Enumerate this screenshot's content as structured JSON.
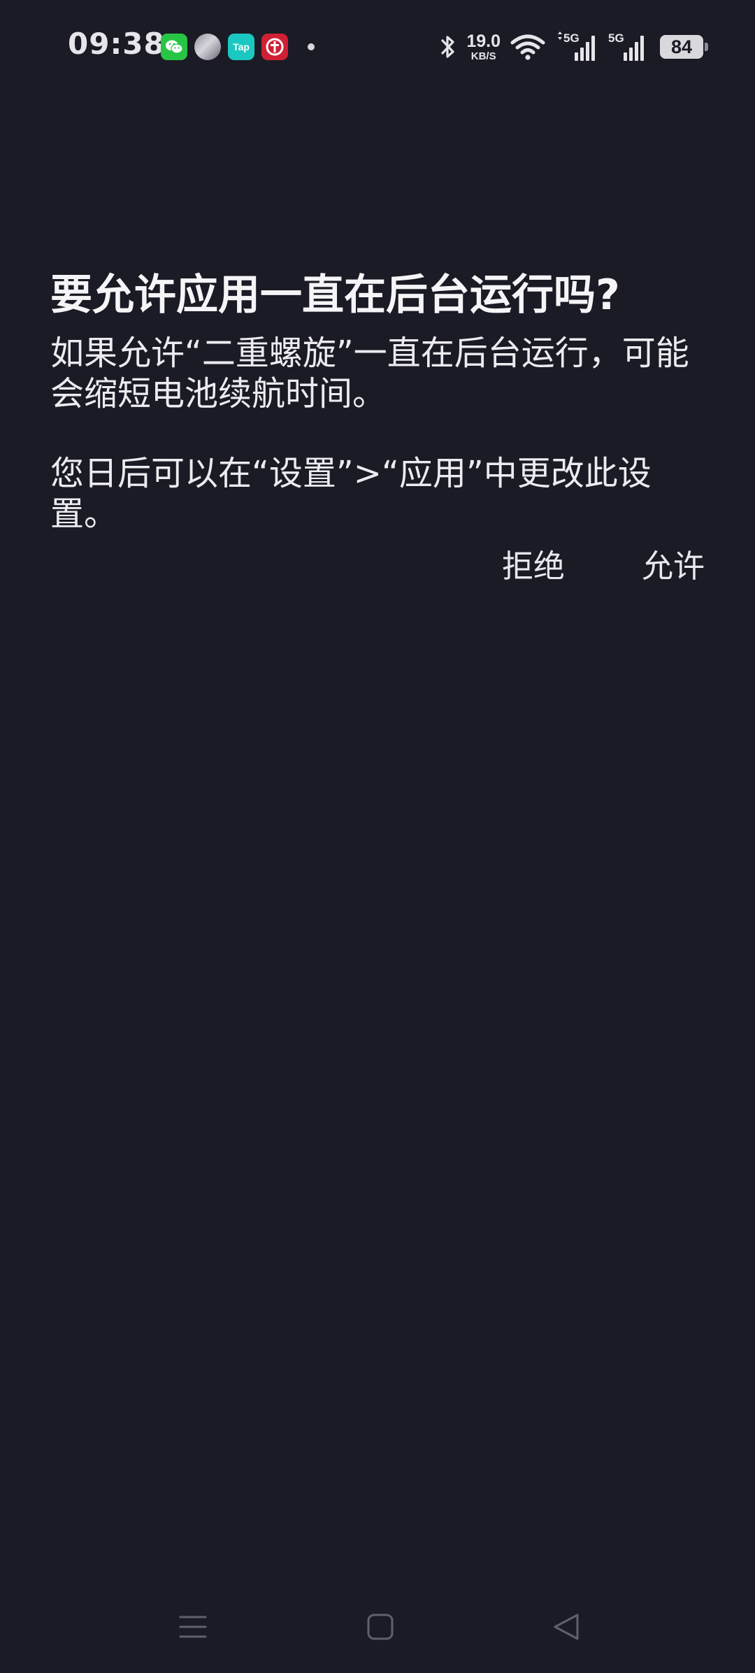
{
  "status_bar": {
    "time": "09:38",
    "notification_icons": [
      {
        "name": "wechat-icon",
        "label": ""
      },
      {
        "name": "game-avatar-icon",
        "label": ""
      },
      {
        "name": "taptap-icon",
        "label": "Tap"
      },
      {
        "name": "railway-icon",
        "label": ""
      }
    ],
    "net_speed_value": "19.0",
    "net_speed_unit": "KB/S",
    "signal_1_label": "5G",
    "signal_2_label": "5G",
    "battery_level": "84",
    "colors": {
      "background": "#1a1b25",
      "text": "#e6e6ea"
    }
  },
  "dialog": {
    "title": "要允许应用一直在后台运行吗?",
    "message": "如果允许“二重螺旋”一直在后台运行，可能会缩短电池续航时间。",
    "hint": "您日后可以在“设置”>“应用”中更改此设置。",
    "deny_label": "拒绝",
    "allow_label": "允许"
  },
  "nav_bar": {
    "icons": [
      "menu-icon",
      "home-icon",
      "back-icon"
    ]
  }
}
